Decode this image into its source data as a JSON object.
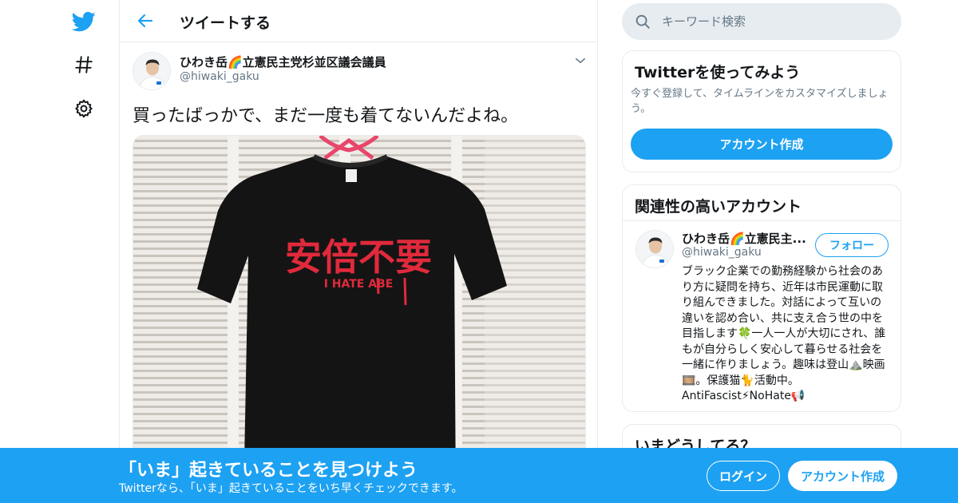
{
  "nav": {
    "home_icon": "twitter-bird-icon",
    "explore_icon": "hashtag-icon",
    "settings_icon": "gear-icon"
  },
  "header": {
    "title": "ツイートする",
    "back_icon": "arrow-left-icon"
  },
  "tweet": {
    "author_name": "ひわき岳🌈立憲民主党杉並区議会議員",
    "author_handle": "@hiwaki_gaku",
    "text": "買ったばっかで、まだ一度も着てないんだよね。",
    "media": {
      "shirt_print_main": "安倍不要",
      "shirt_print_sub": "I HATE ABE"
    }
  },
  "search": {
    "placeholder": "キーワード検索"
  },
  "try_card": {
    "title": "Twitterを使ってみよう",
    "description": "今すぐ登録して、タイムラインをカスタマイズしましょう。",
    "signup_label": "アカウント作成"
  },
  "related": {
    "title": "関連性の高いアカウント",
    "name": "ひわき岳🌈立憲民主...",
    "handle": "@hiwaki_gaku",
    "follow_label": "フォロー",
    "bio": "ブラック企業での勤務経験から社会のあり方に疑問を持ち、近年は市民運動に取り組んできました。対話によって互いの違いを認め合い、共に支え合う世の中を目指します🍀一人一人が大切にされ、誰もが自分らしく安心して暮らせる社会を一緒に作りましょう。趣味は登山⛰️映画🎞️。保護猫🐈活動中。AntiFascist⚡NoHate📢"
  },
  "now_card": {
    "title": "いまどうしてる？"
  },
  "banner": {
    "title": "「いま」起きていることを見つけよう",
    "subtitle": "Twitterなら、「いま」起きていることをいち早くチェックできます。",
    "login_label": "ログイン",
    "signup_label": "アカウント作成"
  },
  "colors": {
    "accent": "#1da1f2",
    "border": "#e6ecf0",
    "secondary_text": "#657786"
  }
}
